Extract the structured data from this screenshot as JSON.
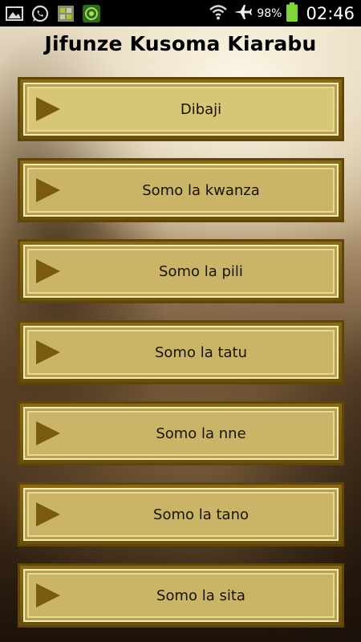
{
  "status_bar": {
    "battery_percent": "98%",
    "time": "02:46",
    "icons": [
      "gallery-icon",
      "whatsapp-icon",
      "android-debug-icon",
      "shield-app-icon",
      "wifi-icon",
      "airplane-icon",
      "battery-icon"
    ],
    "battery_color": "#7fd63a"
  },
  "app": {
    "title": "Jifunze Kusoma Kiarabu"
  },
  "menu": {
    "items": [
      {
        "label": "Dibaji"
      },
      {
        "label": "Somo la kwanza"
      },
      {
        "label": "Somo la pili"
      },
      {
        "label": "Somo la tatu"
      },
      {
        "label": "Somo la nne"
      },
      {
        "label": "Somo la tano"
      },
      {
        "label": "Somo la sita"
      }
    ]
  },
  "colors": {
    "button_outer": "#6b4f0c",
    "button_fill": "#c9b468",
    "button_border_light": "#f6edb0",
    "play_icon": "#7a5a10"
  }
}
